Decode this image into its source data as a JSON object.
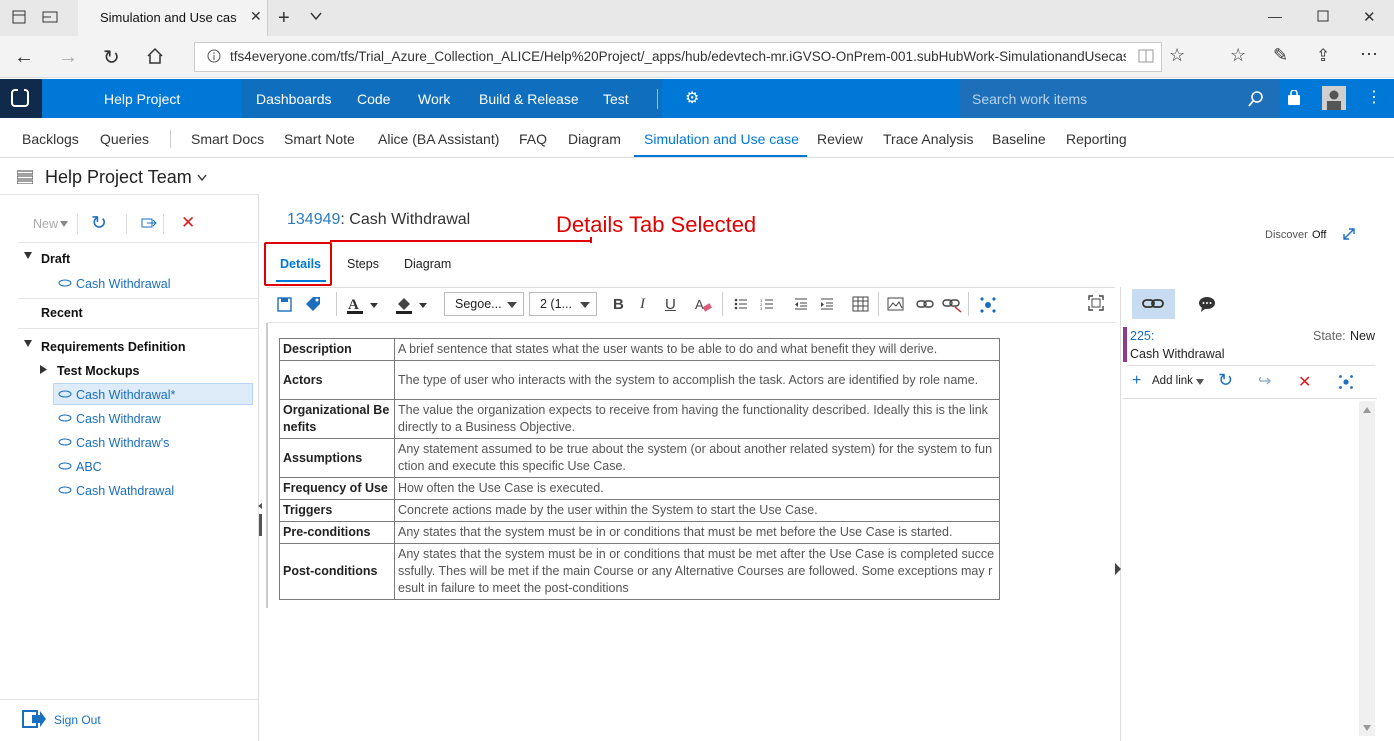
{
  "browser": {
    "tab_title": "Simulation and Use case",
    "url": "tfs4everyone.com/tfs/Trial_Azure_Collection_ALICE/Help%20Project/_apps/hub/edevtech-mr.iGVSO-OnPrem-001.subHubWork-SimulationandUsecase-OnPre"
  },
  "header": {
    "project": "Help Project",
    "nav": [
      "Dashboards",
      "Code",
      "Work",
      "Build & Release",
      "Test"
    ],
    "search_placeholder": "Search work items"
  },
  "subnav": [
    "Backlogs",
    "Queries",
    "Smart Docs",
    "Smart Note",
    "Alice (BA Assistant)",
    "FAQ",
    "Diagram",
    "Simulation and Use case",
    "Review",
    "Trace Analysis",
    "Baseline",
    "Reporting"
  ],
  "team": "Help Project Team",
  "left": {
    "new_label": "New",
    "draft": "Draft",
    "draft_items": [
      "Cash Withdrawal"
    ],
    "recent": "Recent",
    "req_def": "Requirements Definition",
    "test_mockups": "Test Mockups",
    "items": [
      "Cash Withdrawal*",
      "Cash Withdraw",
      "Cash Withdraw's",
      "ABC",
      "Cash Wathdrawal"
    ],
    "sign_out": "Sign Out"
  },
  "workitem": {
    "id": "134949",
    "title": "Cash Withdrawal",
    "annotation": "Details Tab Selected",
    "discover": "Discover",
    "discover_state": "Off",
    "tabs": [
      "Details",
      "Steps",
      "Diagram"
    ],
    "font": "Segoe...",
    "size": "2 (1..."
  },
  "usecase_table": [
    {
      "k": "Description",
      "v": "A brief sentence that states what the user wants to be able to do and what benefit they will derive."
    },
    {
      "k": "Actors",
      "v": "The type of user who interacts with the system to accomplish the task. Actors are identified by role name."
    },
    {
      "k": "Organizational Benefits",
      "v": "The value the organization expects to receive from having the functionality described. Ideally this is the link directly to a Business Objective."
    },
    {
      "k": "Assumptions",
      "v": "Any statement assumed to be true about the system (or about another related system) for the system to function and execute this specific Use Case."
    },
    {
      "k": "Frequency of Use",
      "v": "How often the Use Case is executed."
    },
    {
      "k": "Triggers",
      "v": "Concrete actions made by the user within the System to start the Use Case."
    },
    {
      "k": "Pre-conditions",
      "v": "Any states that the system must be in or conditions that must be met before the Use Case is started."
    },
    {
      "k": "Post-conditions",
      "v": "Any states that the system must be in or conditions that must be met after the Use Case is completed successfully. Thes will be met if the main Course or any Alternative Courses are followed. Some exceptions may result in failure to meet the post-conditions"
    }
  ],
  "links": {
    "id": "225:",
    "title": "Cash Withdrawal",
    "state_label": "State:",
    "state": "New",
    "add_link": "Add link"
  },
  "colors": {
    "accent": "#0078d7",
    "annotation": "#e00000",
    "link": "#1a6fbf"
  }
}
